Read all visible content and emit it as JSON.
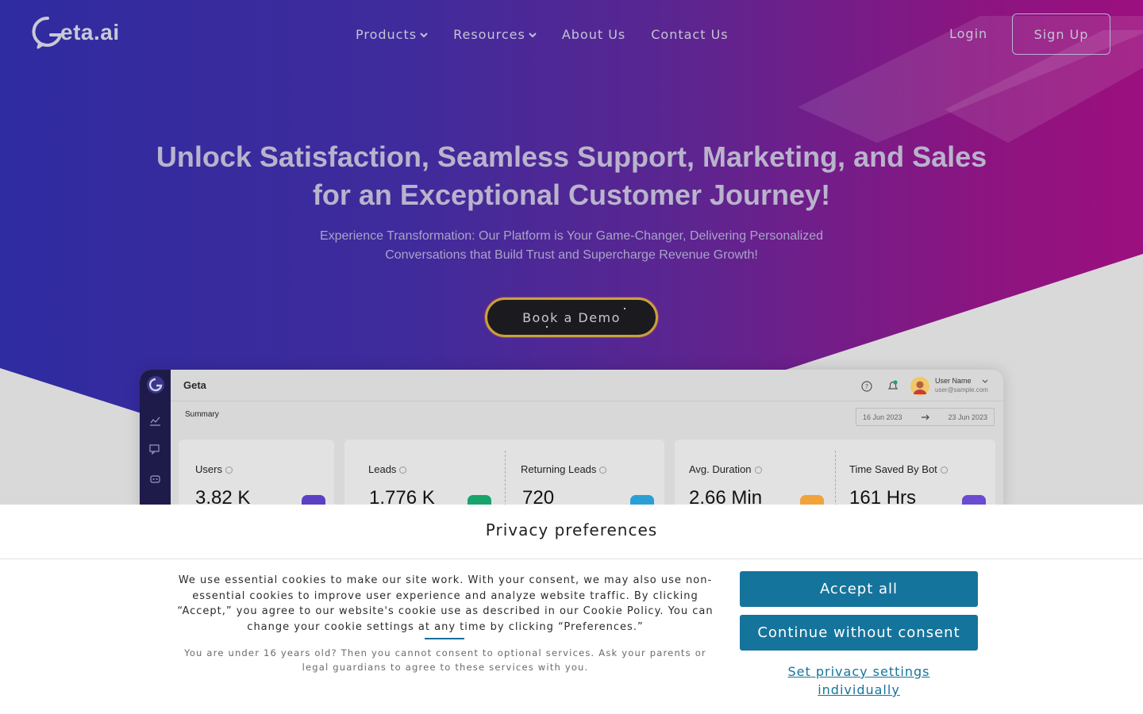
{
  "brand": {
    "name": "Geta.ai",
    "logo_text": "eta.ai"
  },
  "nav": {
    "items": [
      {
        "label": "Products",
        "has_dropdown": true
      },
      {
        "label": "Resources",
        "has_dropdown": true
      },
      {
        "label": "About Us",
        "has_dropdown": false
      },
      {
        "label": "Contact Us",
        "has_dropdown": false
      }
    ],
    "login_label": "Login",
    "signup_label": "Sign Up"
  },
  "hero": {
    "headline_line1": "Unlock Satisfaction, Seamless Support, Marketing, and Sales",
    "headline_line2": "for an Exceptional Customer Journey!",
    "subhead_line1": "Experience Transformation: Our Platform is Your Game-Changer, Delivering Personalized",
    "subhead_line2": "Conversations that Build Trust and Supercharge Revenue Growth!",
    "cta_label": "Book a Demo"
  },
  "dashboard": {
    "brand": "Geta",
    "user_name": "User Name",
    "user_email": "user@sample.com",
    "section": "Summary",
    "date_from": "16 Jun 2023",
    "date_to": "23 Jun 2023",
    "metrics": [
      {
        "label": "Users",
        "value": "3.82 K",
        "color": "#5b3fc4"
      },
      {
        "label": "Leads",
        "value": "1.776 K",
        "color": "#18a36b"
      },
      {
        "label": "Returning Leads",
        "value": "720",
        "color": "#2a9fd6"
      },
      {
        "label": "Avg. Duration",
        "value": "2.66 Min",
        "color": "#f2a23a"
      },
      {
        "label": "Time Saved By Bot",
        "value": "161 Hrs",
        "color": "#6a4bd1"
      }
    ]
  },
  "cookie": {
    "title": "Privacy preferences",
    "text_lines": [
      "We use essential cookies to make our site work. With your consent, we may also use non-",
      "essential cookies to improve user experience and analyze website traffic. By clicking",
      "“Accept,” you agree to our website's cookie use as described in our Cookie Policy. You can",
      "change your cookie settings at any time by clicking “Preferences.”"
    ],
    "note_lines": [
      "You are under 16 years old? Then you cannot consent to optional services. Ask your parents or",
      "legal guardians to agree to these services with you."
    ],
    "accept_label": "Accept all",
    "continue_label": "Continue without consent",
    "settings_line1": "Set privacy settings",
    "settings_line2": "individually"
  },
  "colors": {
    "hero_start": "#2f2ba0",
    "hero_end": "#9c0f7e",
    "cookie_button": "#15749c",
    "dash_sidebar": "#1e1b4b"
  }
}
